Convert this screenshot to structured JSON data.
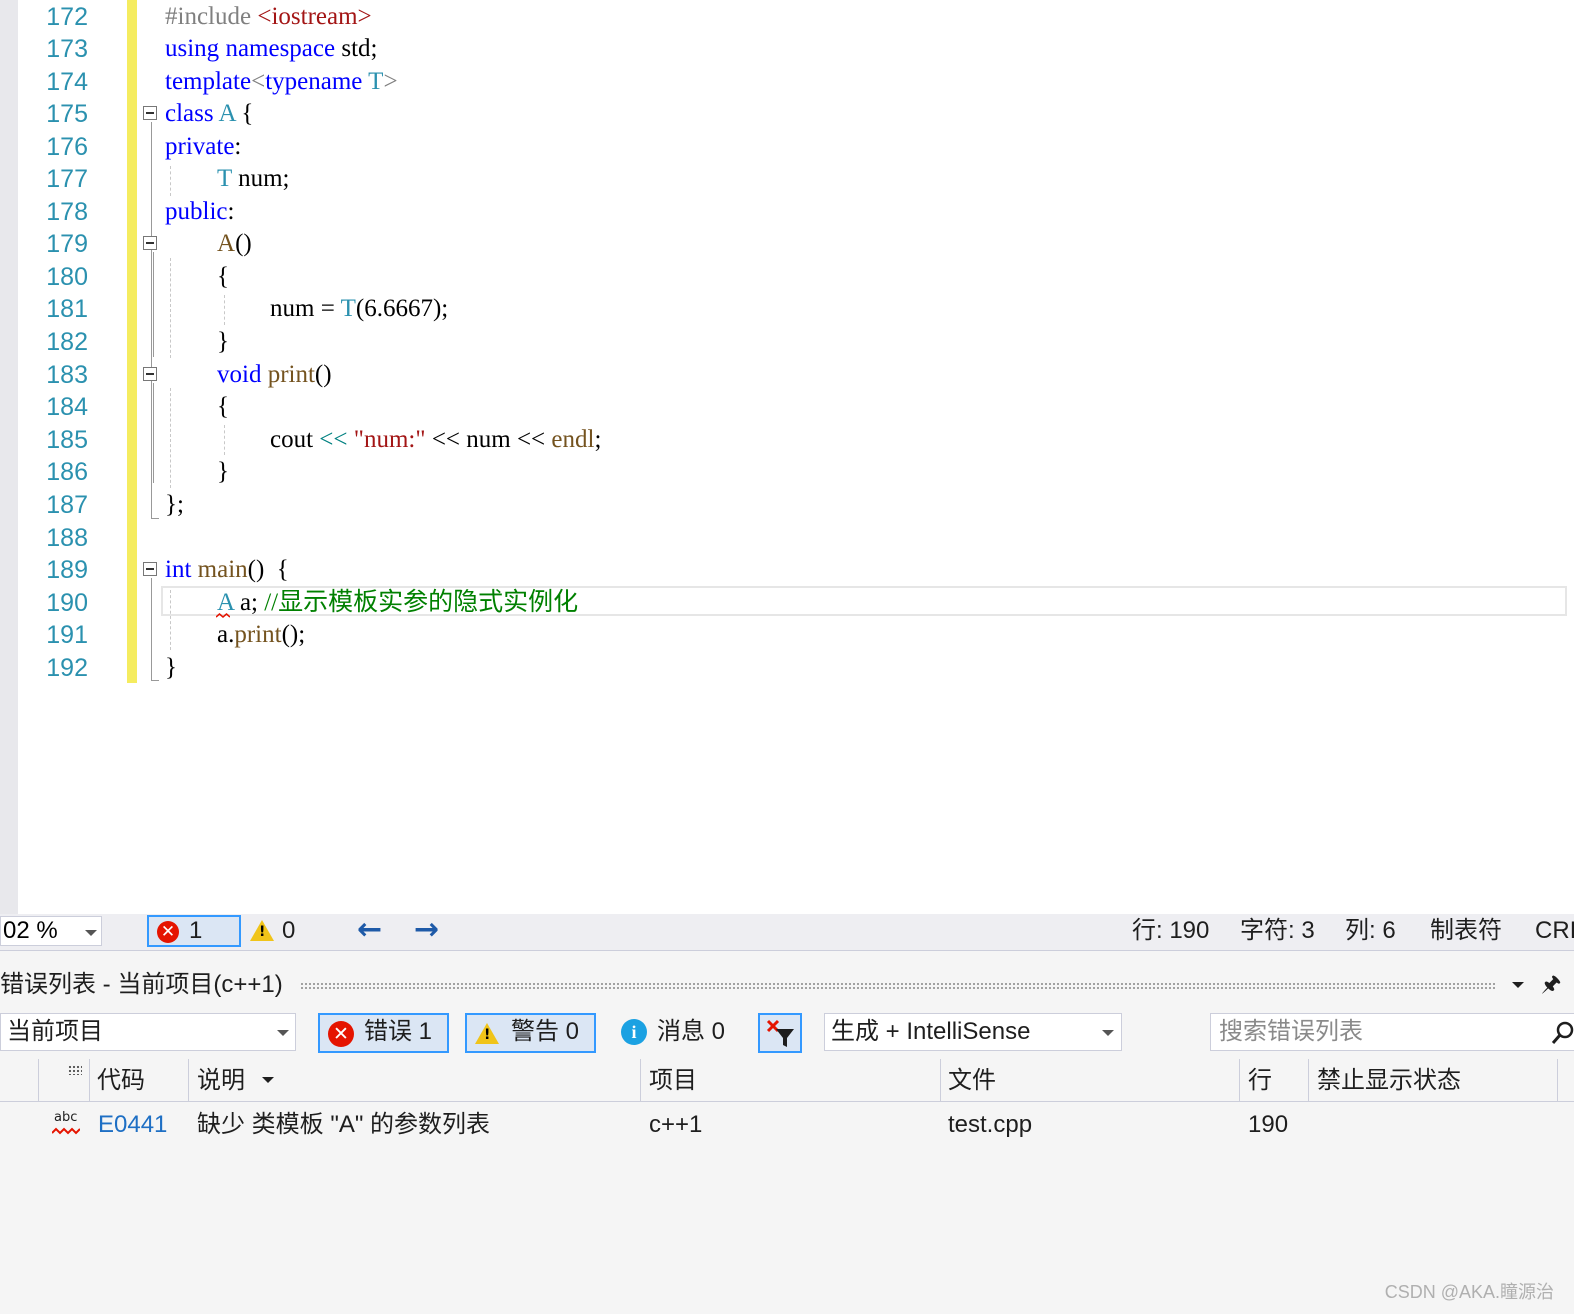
{
  "colors": {
    "keyword": "#0000ff",
    "type": "#2b91af",
    "string": "#a31515",
    "preprocessor": "#808080",
    "comment": "#008000",
    "function": "#74531f",
    "line_number": "#2b91af"
  },
  "editor": {
    "lines": [
      {
        "n": "172",
        "t1": "#include ",
        "t2": "<iostream>"
      },
      {
        "n": "173",
        "t1": "using",
        "t2": " namespace",
        "t3": " std;"
      },
      {
        "n": "174",
        "t1": "template",
        "t2": "<",
        "t3": "typename",
        "t4": " T",
        "t5": ">"
      },
      {
        "n": "175",
        "t1": "class",
        "t2": " A",
        "t3": " {"
      },
      {
        "n": "176",
        "t1": "private",
        "t2": ":"
      },
      {
        "n": "177",
        "t1": "T",
        "t2": " num;"
      },
      {
        "n": "178",
        "t1": "public",
        "t2": ":"
      },
      {
        "n": "179",
        "t1": "A",
        "t2": "()"
      },
      {
        "n": "180",
        "t1": "{"
      },
      {
        "n": "181",
        "t1": "num = ",
        "t2": "T",
        "t3": "(6.6667);"
      },
      {
        "n": "182",
        "t1": "}"
      },
      {
        "n": "183",
        "t1": "void",
        "t2": " print",
        "t3": "()"
      },
      {
        "n": "184",
        "t1": "{"
      },
      {
        "n": "185",
        "t1": "cout",
        "t2": " << ",
        "t3": "\"num:\"",
        "t4": " << num << ",
        "t5": "endl",
        "t6": ";"
      },
      {
        "n": "186",
        "t1": "}"
      },
      {
        "n": "187",
        "t1": "};"
      },
      {
        "n": "188"
      },
      {
        "n": "189",
        "t1": "int",
        "t2": " main",
        "t3": "()  {"
      },
      {
        "n": "190",
        "t1": "A",
        "t2": " a; ",
        "t3": "//显示模板实参的隐式实例化"
      },
      {
        "n": "191",
        "t1": "a.",
        "t2": "print",
        "t3": "();"
      },
      {
        "n": "192",
        "t1": "}"
      }
    ]
  },
  "status_bar": {
    "zoom": "02 %",
    "error_count": "1",
    "warning_count": "0",
    "nav_back": "←",
    "nav_forward": "→",
    "line": "行: 190",
    "char": "字符: 3",
    "col": "列: 6",
    "tabs": "制表符",
    "eol": "CRI"
  },
  "error_list": {
    "title": "错误列表 - 当前项目(c++1)",
    "pin": "🖈",
    "scope": "当前项目",
    "errors_btn": "错误 1",
    "warnings_btn": "警告 0",
    "messages_btn": "消息 0",
    "build_filter": "生成 + IntelliSense",
    "search_placeholder": "搜索错误列表",
    "columns": {
      "code": "代码",
      "desc": "说明",
      "project": "项目",
      "file": "文件",
      "line": "行",
      "suppress": "禁止显示状态"
    },
    "rows": [
      {
        "icon": "abc",
        "code": "E0441",
        "desc": "缺少 类模板 \"A\" 的参数列表",
        "project": "c++1",
        "file": "test.cpp",
        "line": "190",
        "suppress": ""
      }
    ]
  },
  "watermark": "CSDN @AKA.瞳源治"
}
